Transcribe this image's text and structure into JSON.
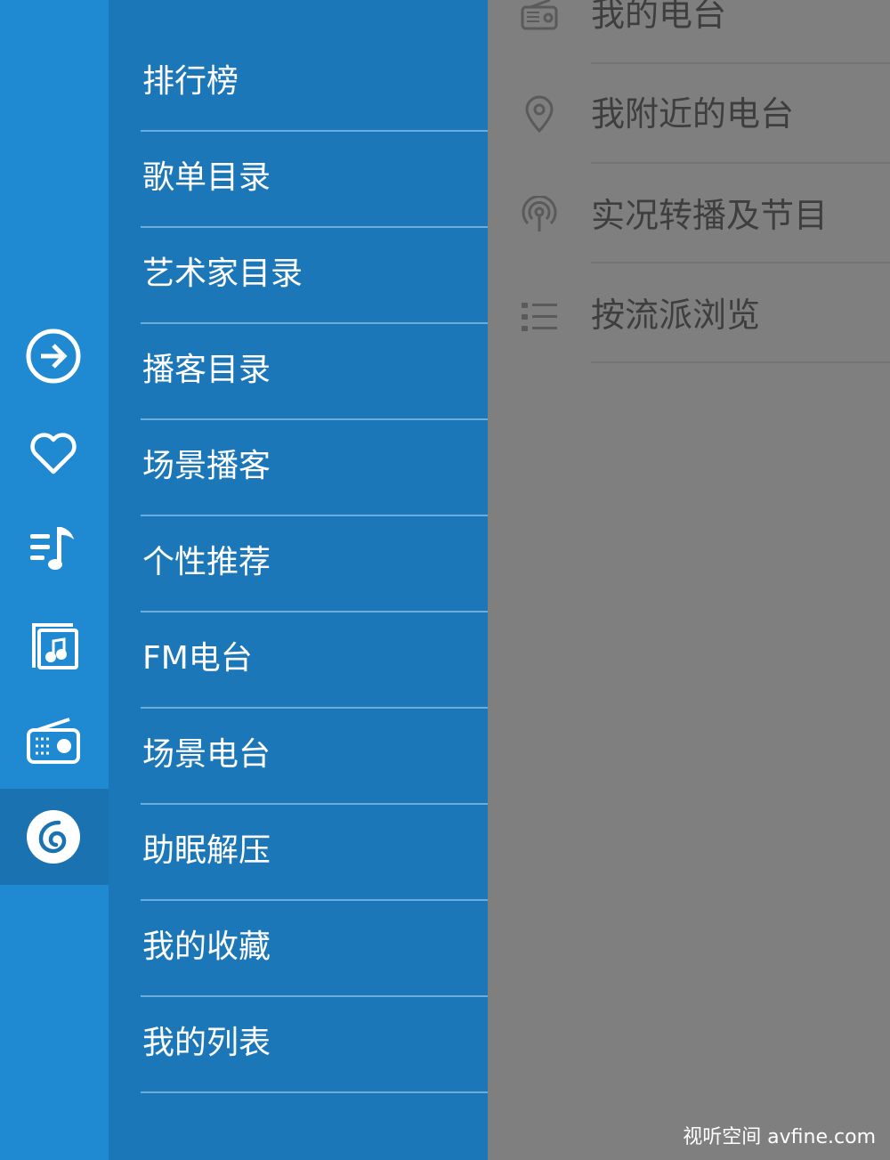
{
  "rail": {
    "icons": [
      "arrow-right-circle-icon",
      "heart-icon",
      "music-queue-icon",
      "album-icon",
      "radio-icon",
      "netease-music-icon"
    ],
    "active_index": 5
  },
  "menu": {
    "items": [
      {
        "label": "排行榜"
      },
      {
        "label": "歌单目录"
      },
      {
        "label": "艺术家目录"
      },
      {
        "label": "播客目录"
      },
      {
        "label": "场景播客"
      },
      {
        "label": "个性推荐"
      },
      {
        "label": "FM电台"
      },
      {
        "label": "场景电台"
      },
      {
        "label": "助眠解压"
      },
      {
        "label": "我的收藏"
      },
      {
        "label": "我的列表"
      }
    ]
  },
  "right": {
    "items": [
      {
        "label": "我的电台",
        "icon": "radio-icon"
      },
      {
        "label": "我附近的电台",
        "icon": "location-pin-icon"
      },
      {
        "label": "实况转播及节目",
        "icon": "broadcast-icon"
      },
      {
        "label": "按流派浏览",
        "icon": "list-icon"
      }
    ]
  },
  "watermark": "视听空间 avfine.com",
  "colors": {
    "rail": "#1f8ad1",
    "menu": "#1c77b9",
    "rail_active": "#1a72b1",
    "overlay": "#7f7f7f"
  }
}
